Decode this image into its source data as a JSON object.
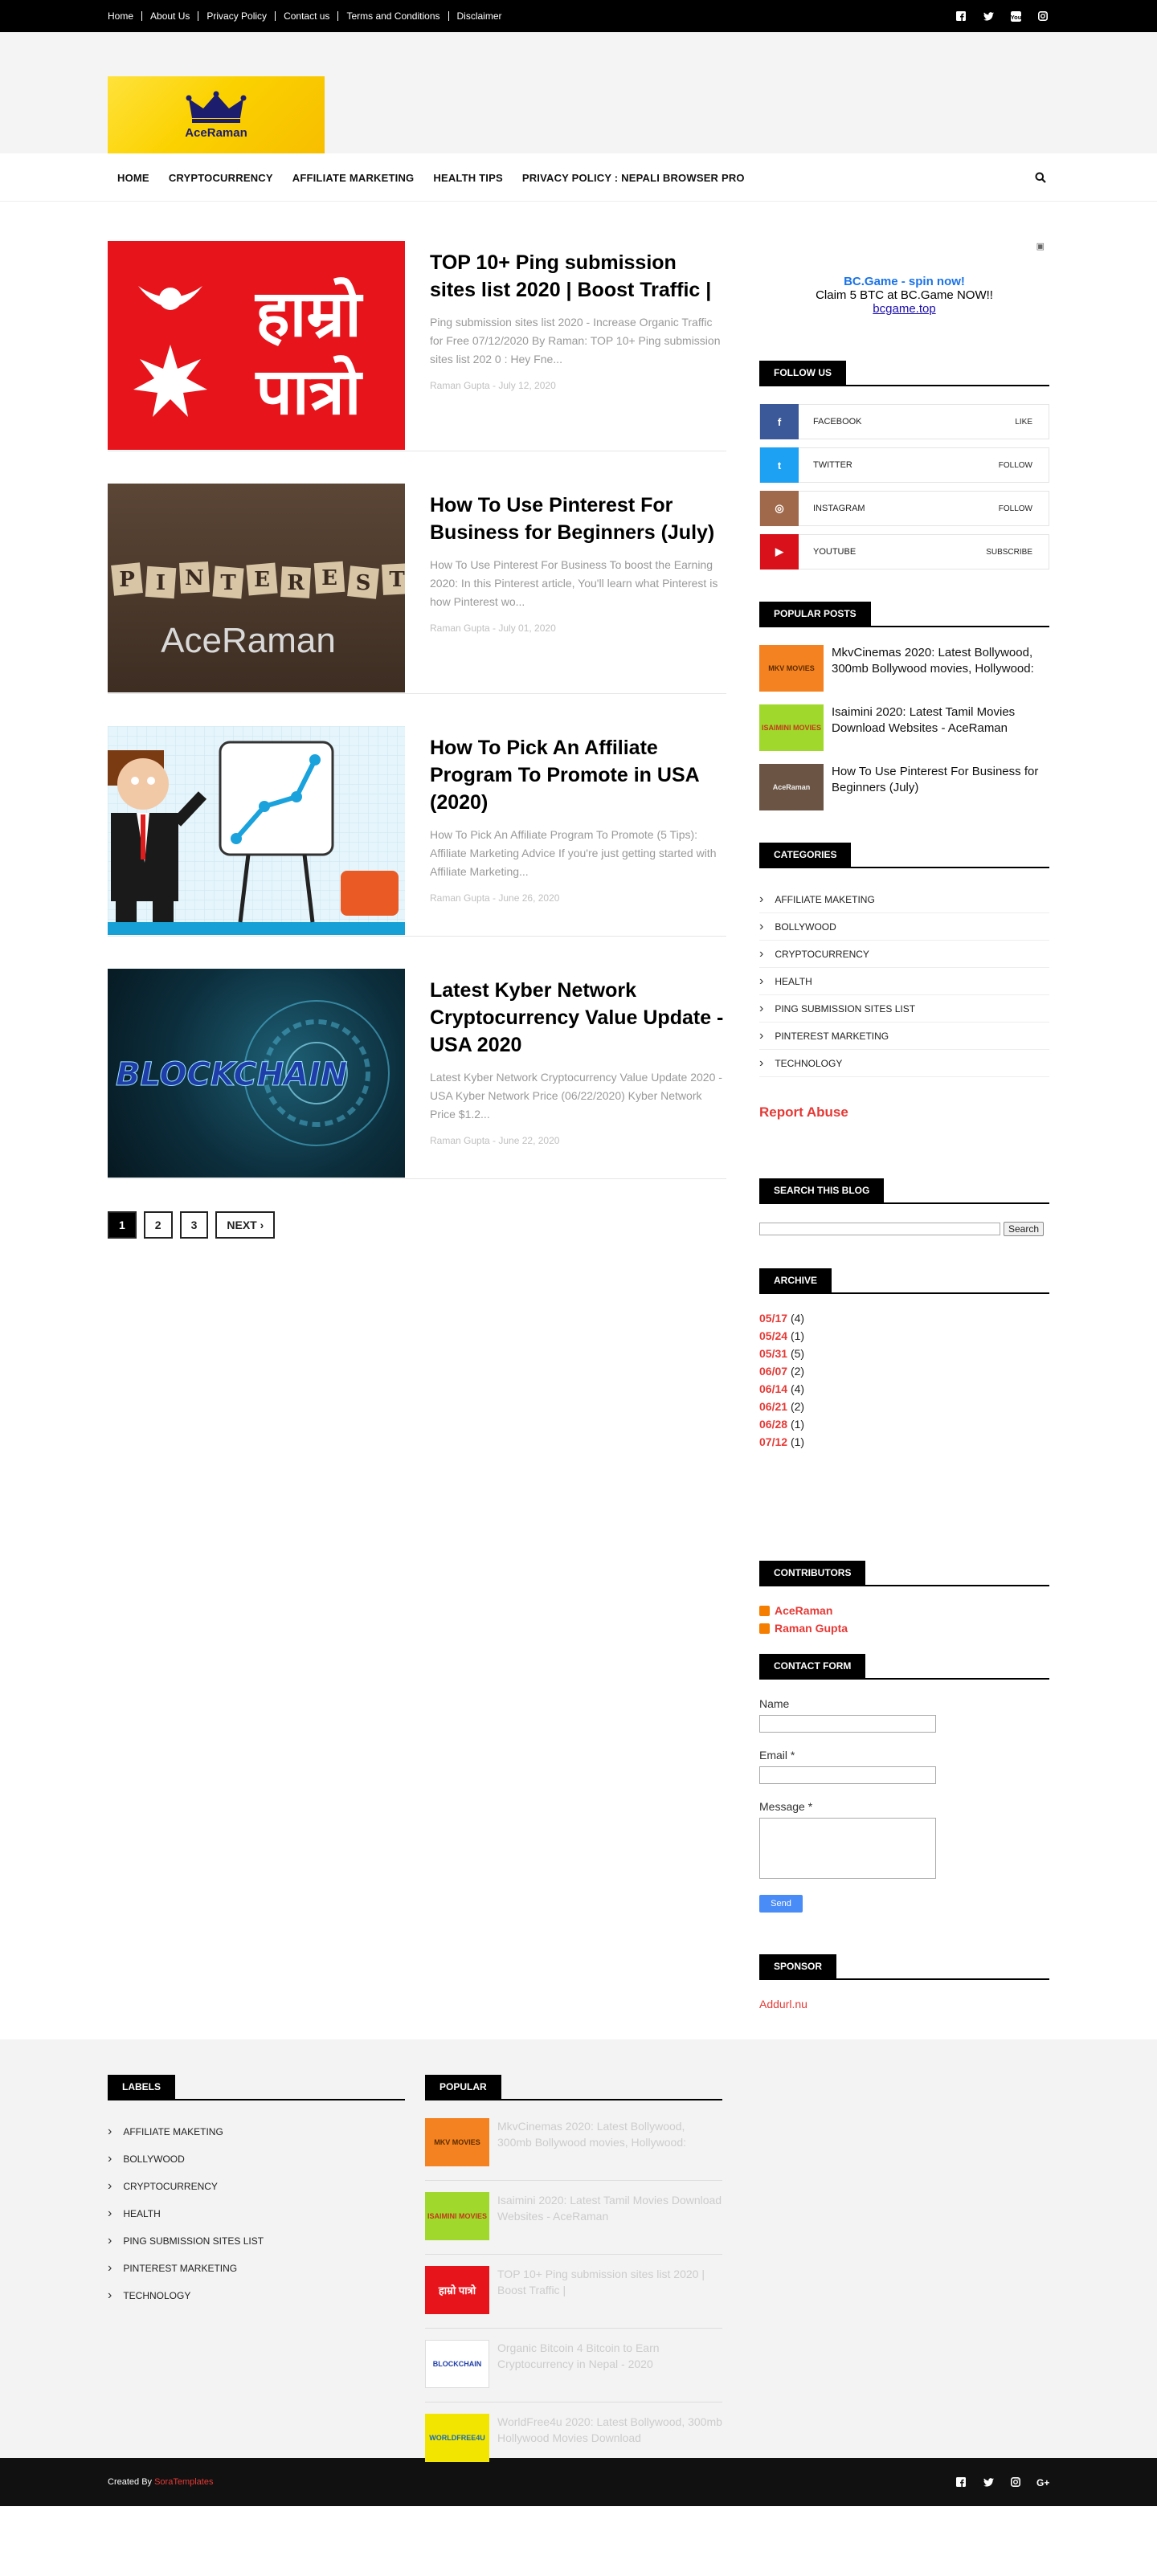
{
  "topbar": {
    "links": [
      "Home",
      "About Us",
      "Privacy Policy",
      "Contact us",
      "Terms and Conditions",
      "Disclaimer"
    ],
    "social_icons": [
      "facebook-icon",
      "twitter-icon",
      "youtube-icon",
      "instagram-icon"
    ]
  },
  "logo": {
    "text": "AceRaman"
  },
  "nav": {
    "items": [
      "HOME",
      "CRYPTOCURRENCY",
      "AFFILIATE MARKETING",
      "HEALTH TIPS",
      "PRIVACY POLICY : NEPALI BROWSER PRO"
    ]
  },
  "posts": [
    {
      "title": "TOP 10+ Ping submission sites list 2020 | Boost Traffic |",
      "snippet": "Ping submission sites list 2020 - Increase Organic Traffic for Free 07/12/2020 By Raman: TOP 10+ Ping submission sites list 202 0 : Hey Fne...",
      "meta": "Raman Gupta - July 12, 2020",
      "thumb_text": "हाम्रो पात्रो"
    },
    {
      "title": "How To Use Pinterest For Business for Beginners (July)",
      "snippet": "How To Use Pinterest For Business To boost the Earning 2020: In this Pinterest article,  You'll learn what Pinterest is how Pinterest wo...",
      "meta": "Raman Gupta - July 01, 2020",
      "thumb_text": "PINTEREST",
      "thumb_sub": "AceRaman"
    },
    {
      "title": "How To Pick An Affiliate Program To Promote in USA (2020)",
      "snippet": "How To Pick An Affiliate Program To Promote (5 Tips): Affiliate Marketing Advice If you're just getting started with Affiliate Marketing...",
      "meta": "Raman Gupta - June 26, 2020"
    },
    {
      "title": "Latest Kyber Network Cryptocurrency Value Update - USA 2020",
      "snippet": "Latest Kyber Network Cryptocurrency Value Update 2020 - USA Kyber Network Price (06/22/2020) Kyber Network Price                       $1.2...",
      "meta": "Raman Gupta - June 22, 2020",
      "thumb_text": "BLOCKCHAIN"
    }
  ],
  "pager": {
    "pages": [
      "1",
      "2",
      "3"
    ],
    "next": "NEXT ›"
  },
  "ad": {
    "title": "BC.Game - spin now!",
    "text": "Claim 5 BTC at BC.Game NOW!!",
    "link": "bcgame.top"
  },
  "follow": {
    "title": "FOLLOW US",
    "items": [
      {
        "name": "FACEBOOK",
        "action": "LIKE",
        "color": "#3b5998",
        "glyph": "f"
      },
      {
        "name": "TWITTER",
        "action": "FOLLOW",
        "color": "#1da1f2",
        "glyph": "t"
      },
      {
        "name": "INSTAGRAM",
        "action": "FOLLOW",
        "color": "#a0694b",
        "glyph": "◎"
      },
      {
        "name": "YOUTUBE",
        "action": "SUBSCRIBE",
        "color": "#d8111b",
        "glyph": "▶"
      }
    ]
  },
  "popular": {
    "title": "POPULAR POSTS",
    "items": [
      {
        "title": "MkvCinemas 2020: Latest Bollywood, 300mb Bollywood movies, Hollywood:",
        "thumb": "MKV MOVIES",
        "color": "#f58220"
      },
      {
        "title": "Isaimini 2020: Latest Tamil Movies Download Websites - AceRaman",
        "thumb": "ISAIMINI MOVIES",
        "color": "#a0d82b"
      },
      {
        "title": "How To Use Pinterest For Business for Beginners (July)",
        "thumb": "AceRaman",
        "color": "#6b5443"
      }
    ]
  },
  "categories": {
    "title": "CATEGORIES",
    "items": [
      "AFFILIATE MAKETING",
      "BOLLYWOOD",
      "CRYPTOCURRENCY",
      "HEALTH",
      "PING SUBMISSION SITES LIST",
      "PINTEREST MARKETING",
      "TECHNOLOGY"
    ]
  },
  "report_abuse": "Report Abuse",
  "search_widget": {
    "title": "SEARCH THIS BLOG",
    "button": "Search"
  },
  "archive": {
    "title": "ARCHIVE",
    "items": [
      {
        "month": "05/17",
        "count": "(4)"
      },
      {
        "month": "05/24",
        "count": "(1)"
      },
      {
        "month": "05/31",
        "count": "(5)"
      },
      {
        "month": "06/07",
        "count": "(2)"
      },
      {
        "month": "06/14",
        "count": "(4)"
      },
      {
        "month": "06/21",
        "count": "(2)"
      },
      {
        "month": "06/28",
        "count": "(1)"
      },
      {
        "month": "07/12",
        "count": "(1)"
      }
    ]
  },
  "contributors": {
    "title": "CONTRIBUTORS",
    "items": [
      "AceRaman",
      "Raman Gupta"
    ]
  },
  "contact": {
    "title": "CONTACT FORM",
    "name": "Name",
    "email": "Email *",
    "message": "Message *",
    "send": "Send"
  },
  "sponsor": {
    "title": "SPONSOR",
    "link": "Addurl.nu"
  },
  "footer": {
    "labels_title": "LABELS",
    "labels": [
      "AFFILIATE MAKETING",
      "BOLLYWOOD",
      "CRYPTOCURRENCY",
      "HEALTH",
      "PING SUBMISSION SITES LIST",
      "PINTEREST MARKETING",
      "TECHNOLOGY"
    ],
    "popular_title": "POPULAR",
    "popular": [
      {
        "title": "MkvCinemas 2020: Latest Bollywood, 300mb Bollywood movies, Hollywood:",
        "thumb": "MKV MOVIES",
        "color": "#f58220"
      },
      {
        "title": "Isaimini 2020: Latest Tamil Movies Download Websites - AceRaman",
        "thumb": "ISAIMINI MOVIES",
        "color": "#a0d82b"
      },
      {
        "title": "TOP 10+ Ping submission sites list 2020 | Boost Traffic |",
        "thumb": "हाम्रो पात्रो",
        "color": "#e8141b"
      },
      {
        "title": "Organic Bitcoin 4 Bitcoin to Earn Cryptocurrency in Nepal - 2020",
        "thumb": "BLOCKCHAIN",
        "color": "#ffffff"
      },
      {
        "title": "WorldFree4u 2020: Latest Bollywood, 300mb Hollywood Movies Download",
        "thumb": "WORLDFREE4U",
        "color": "#f2e600"
      }
    ]
  },
  "bottombar": {
    "credit_prefix": "Created By ",
    "credit_link": "SoraTemplates"
  }
}
